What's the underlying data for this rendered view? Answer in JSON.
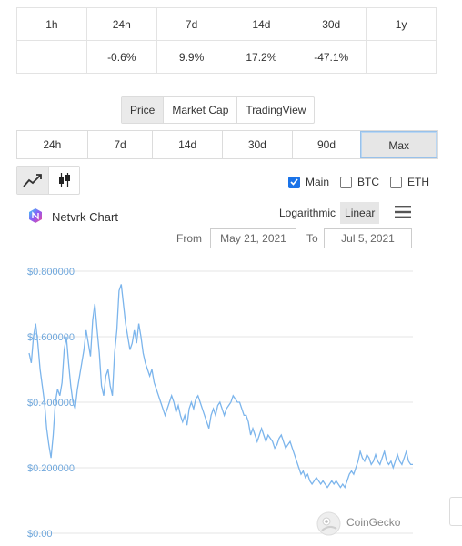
{
  "change_table": {
    "periods": [
      "1h",
      "24h",
      "7d",
      "14d",
      "30d",
      "1y"
    ],
    "changes": [
      "",
      "-0.6%",
      "9.9%",
      "17.2%",
      "-47.1%",
      ""
    ]
  },
  "view_tabs": [
    "Price",
    "Market Cap",
    "TradingView"
  ],
  "range_tabs": [
    "24h",
    "7d",
    "14d",
    "30d",
    "90d",
    "Max"
  ],
  "chart_type_icons": [
    "line-chart-icon",
    "candlestick-icon"
  ],
  "compare_checks": [
    {
      "label": "Main",
      "checked": true
    },
    {
      "label": "BTC",
      "checked": false
    },
    {
      "label": "ETH",
      "checked": false
    }
  ],
  "chart_header": {
    "title": "Netvrk Chart",
    "scale_options": [
      "Logarithmic",
      "Linear"
    ],
    "active_scale": "Linear"
  },
  "date_range": {
    "from_label": "From",
    "from_value": "May 21, 2021",
    "to_label": "To",
    "to_value": "Jul 5, 2021"
  },
  "watermark": "CoinGecko",
  "colors": {
    "line": "#7cb5ec",
    "negative": "#e15241",
    "positive": "#4eaf0a",
    "checkbox": "#1a73e8"
  },
  "chart_data": {
    "type": "line",
    "y_tick_labels": [
      "$0.800000",
      "$0.600000",
      "$0.400000",
      "$0.200000",
      "$0.00"
    ],
    "ylim": [
      0,
      0.8
    ],
    "x_range": [
      "May 21, 2021",
      "Jul 5, 2021"
    ],
    "grid": true,
    "series": [
      {
        "values": [
          0.55,
          0.52,
          0.6,
          0.64,
          0.58,
          0.5,
          0.45,
          0.4,
          0.32,
          0.27,
          0.23,
          0.3,
          0.4,
          0.44,
          0.42,
          0.46,
          0.56,
          0.6,
          0.52,
          0.45,
          0.4,
          0.38,
          0.44,
          0.48,
          0.52,
          0.56,
          0.62,
          0.58,
          0.54,
          0.65,
          0.7,
          0.62,
          0.55,
          0.45,
          0.42,
          0.48,
          0.5,
          0.45,
          0.42,
          0.55,
          0.62,
          0.74,
          0.76,
          0.7,
          0.64,
          0.6,
          0.56,
          0.58,
          0.62,
          0.58,
          0.64,
          0.6,
          0.55,
          0.52,
          0.5,
          0.48,
          0.5,
          0.46,
          0.44,
          0.42,
          0.4,
          0.38,
          0.36,
          0.38,
          0.4,
          0.42,
          0.4,
          0.37,
          0.39,
          0.36,
          0.34,
          0.36,
          0.33,
          0.38,
          0.4,
          0.38,
          0.41,
          0.42,
          0.4,
          0.38,
          0.36,
          0.34,
          0.32,
          0.36,
          0.38,
          0.36,
          0.39,
          0.4,
          0.38,
          0.36,
          0.38,
          0.39,
          0.4,
          0.42,
          0.41,
          0.4,
          0.4,
          0.38,
          0.36,
          0.36,
          0.34,
          0.3,
          0.32,
          0.3,
          0.28,
          0.3,
          0.32,
          0.3,
          0.28,
          0.3,
          0.29,
          0.28,
          0.26,
          0.27,
          0.29,
          0.3,
          0.28,
          0.26,
          0.27,
          0.28,
          0.26,
          0.24,
          0.22,
          0.2,
          0.18,
          0.19,
          0.17,
          0.18,
          0.16,
          0.15,
          0.16,
          0.17,
          0.16,
          0.15,
          0.16,
          0.15,
          0.14,
          0.15,
          0.16,
          0.15,
          0.16,
          0.15,
          0.14,
          0.15,
          0.14,
          0.16,
          0.18,
          0.19,
          0.18,
          0.2,
          0.22,
          0.25,
          0.23,
          0.22,
          0.24,
          0.23,
          0.21,
          0.22,
          0.24,
          0.22,
          0.21,
          0.23,
          0.25,
          0.22,
          0.21,
          0.22,
          0.2,
          0.22,
          0.24,
          0.22,
          0.21,
          0.23,
          0.25,
          0.22,
          0.21,
          0.21
        ]
      }
    ]
  }
}
